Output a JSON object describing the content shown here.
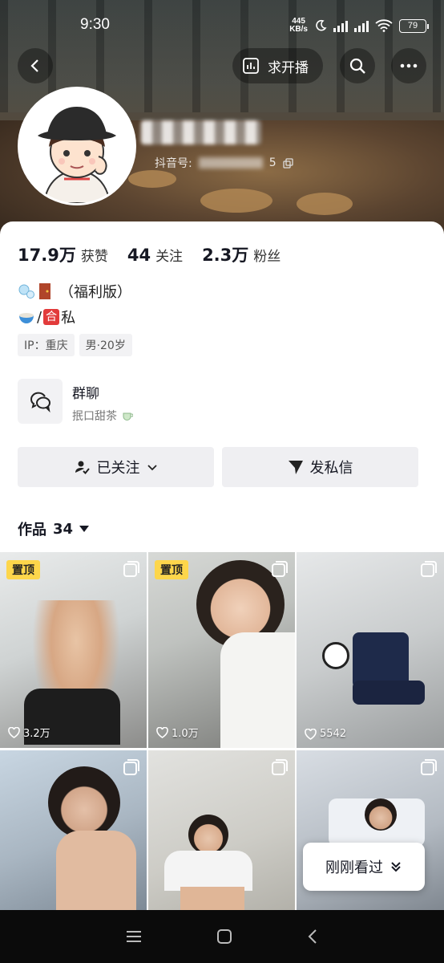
{
  "status_bar": {
    "time": "9:30",
    "net_speed": "445",
    "net_unit": "KB/s",
    "battery": "79"
  },
  "header": {
    "live_button_label": "求开播",
    "douyin_id_label": "抖音号:",
    "douyin_id_tail": "5"
  },
  "stats": [
    {
      "value": "17.9万",
      "label": "获赞"
    },
    {
      "value": "44",
      "label": "关注"
    },
    {
      "value": "2.3万",
      "label": "粉丝"
    }
  ],
  "bio": {
    "line1_text": "（福利版）",
    "line2_sep": "/",
    "line2_box": "合",
    "line2_text": "私"
  },
  "tags": [
    "IP：重庆",
    "男·20岁"
  ],
  "group_chat": {
    "title": "群聊",
    "desc": "抿口甜茶"
  },
  "actions": {
    "followed_label": "已关注",
    "message_label": "发私信"
  },
  "works_tab": {
    "label": "作品",
    "count": "34"
  },
  "works": [
    {
      "pinned": "置顶",
      "likes": "3.2万"
    },
    {
      "pinned": "置顶",
      "likes": "1.0万"
    },
    {
      "pinned": "",
      "likes": "5542"
    },
    {
      "pinned": "",
      "likes": ""
    },
    {
      "pinned": "",
      "likes": ""
    },
    {
      "pinned": "",
      "likes": ""
    }
  ],
  "recent_button": {
    "label": "刚刚看过"
  },
  "colors": {
    "pin_yellow": "#fdd64b",
    "panel_bg": "#ffffff",
    "button_bg": "#efeff2",
    "text_primary": "#161823"
  }
}
